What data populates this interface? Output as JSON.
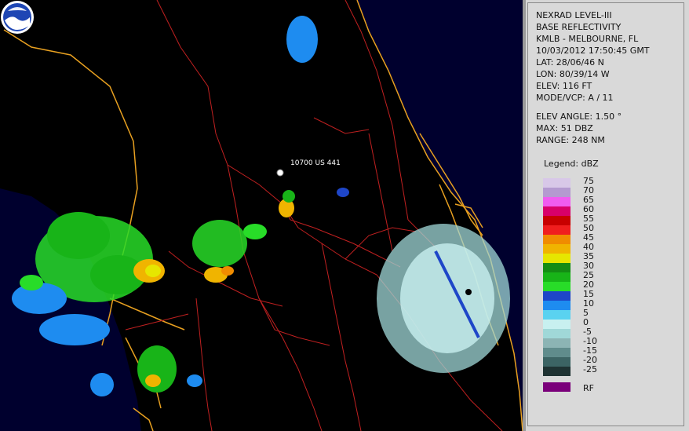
{
  "info": {
    "product": "NEXRAD LEVEL-III",
    "type": "BASE REFLECTIVITY",
    "station": "KMLB - MELBOURNE, FL",
    "datetime": "10/03/2012 17:50:45 GMT",
    "lat": "LAT: 28/06/46 N",
    "lon": "LON: 80/39/14 W",
    "elev": "ELEV: 116 FT",
    "mode": "MODE/VCP: A / 11",
    "elev_angle": "ELEV ANGLE: 1.50 °",
    "max": "MAX: 51 DBZ",
    "range": "RANGE: 248 NM"
  },
  "legend": {
    "title": "Legend: dBZ",
    "levels": [
      {
        "label": "75",
        "color": "#d8c8e8"
      },
      {
        "label": "70",
        "color": "#b49ad0"
      },
      {
        "label": "65",
        "color": "#f05cf0"
      },
      {
        "label": "60",
        "color": "#d8006a"
      },
      {
        "label": "55",
        "color": "#c80000"
      },
      {
        "label": "50",
        "color": "#f01e1e"
      },
      {
        "label": "45",
        "color": "#f08c00"
      },
      {
        "label": "40",
        "color": "#f0b400"
      },
      {
        "label": "35",
        "color": "#e6e600"
      },
      {
        "label": "30",
        "color": "#148c14"
      },
      {
        "label": "25",
        "color": "#18b418"
      },
      {
        "label": "20",
        "color": "#28dc28"
      },
      {
        "label": "15",
        "color": "#1e46c8"
      },
      {
        "label": "10",
        "color": "#1e8cf0"
      },
      {
        "label": "5",
        "color": "#5ad2f0"
      },
      {
        "label": "0",
        "color": "#c8f0f0"
      },
      {
        "label": "-5",
        "color": "#a0d8d8"
      },
      {
        "label": "-10",
        "color": "#8cb4b4"
      },
      {
        "label": "-15",
        "color": "#608c8c"
      },
      {
        "label": "-20",
        "color": "#3c6464"
      },
      {
        "label": "-25",
        "color": "#1e3232"
      }
    ],
    "rf_label": "RF",
    "rf_color": "#7a007a"
  },
  "map": {
    "marker_label": "10700 US 441",
    "land_color": "#000000",
    "water_color": "#000033",
    "road_color": "#cc2222",
    "county_color": "#e8a020",
    "logo_icon": "noaa-logo-icon"
  }
}
